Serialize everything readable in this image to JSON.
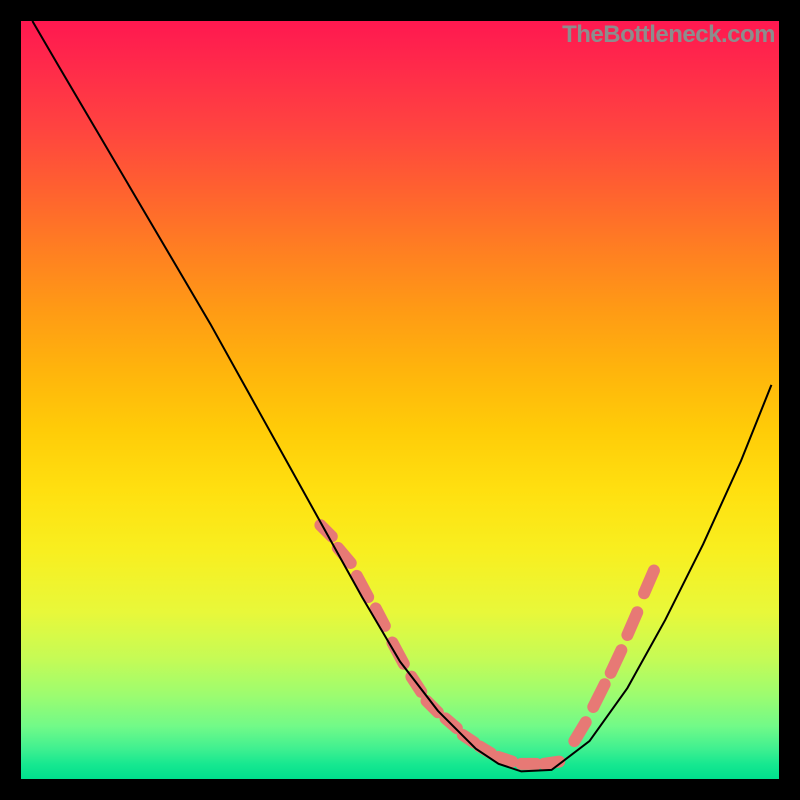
{
  "watermark": "TheBottleneck.com",
  "chart_data": {
    "type": "line",
    "title": "",
    "xlabel": "",
    "ylabel": "",
    "xlim": [
      0,
      100
    ],
    "ylim": [
      0,
      100
    ],
    "grid": false,
    "highlight_color": "#e77975",
    "highlight_width": 12,
    "series": [
      {
        "name": "bottleneck-curve",
        "color": "#000",
        "x": [
          1.5,
          5.0,
          10.0,
          15.0,
          20.0,
          25.0,
          30.0,
          35.0,
          40.0,
          45.0,
          50.0,
          55.0,
          60.0,
          63.0,
          66.0,
          70.0,
          75.0,
          80.0,
          85.0,
          90.0,
          95.0,
          99.0
        ],
        "y": [
          100,
          94,
          85.5,
          77,
          68.5,
          60,
          51,
          42,
          33,
          24,
          15.5,
          9,
          4,
          2,
          1,
          1.2,
          5,
          12,
          21,
          31,
          42,
          52
        ]
      }
    ],
    "highlight_segments": [
      {
        "x0": 39.5,
        "y0": 33.5,
        "x1": 41.0,
        "y1": 32.0
      },
      {
        "x0": 41.8,
        "y0": 30.5,
        "x1": 43.5,
        "y1": 28.5
      },
      {
        "x0": 44.3,
        "y0": 26.8,
        "x1": 45.8,
        "y1": 24.0
      },
      {
        "x0": 46.8,
        "y0": 22.5,
        "x1": 48.0,
        "y1": 20.2
      },
      {
        "x0": 49.0,
        "y0": 18.0,
        "x1": 50.5,
        "y1": 15.2
      },
      {
        "x0": 51.5,
        "y0": 13.5,
        "x1": 52.8,
        "y1": 11.5
      },
      {
        "x0": 53.5,
        "y0": 10.3,
        "x1": 55.0,
        "y1": 8.8
      },
      {
        "x0": 56.0,
        "y0": 8.0,
        "x1": 57.5,
        "y1": 6.7
      },
      {
        "x0": 58.3,
        "y0": 5.8,
        "x1": 59.8,
        "y1": 4.8
      },
      {
        "x0": 60.5,
        "y0": 4.3,
        "x1": 62.0,
        "y1": 3.4
      },
      {
        "x0": 63.0,
        "y0": 2.9,
        "x1": 64.8,
        "y1": 2.3
      },
      {
        "x0": 66.0,
        "y0": 2.0,
        "x1": 68.0,
        "y1": 2.0
      },
      {
        "x0": 69.0,
        "y0": 2.0,
        "x1": 71.0,
        "y1": 2.3
      },
      {
        "x0": 73.0,
        "y0": 5.0,
        "x1": 74.5,
        "y1": 7.5
      },
      {
        "x0": 75.5,
        "y0": 9.5,
        "x1": 77.0,
        "y1": 12.5
      },
      {
        "x0": 77.8,
        "y0": 14.0,
        "x1": 79.2,
        "y1": 17.0
      },
      {
        "x0": 80.0,
        "y0": 19.0,
        "x1": 81.3,
        "y1": 22.0
      },
      {
        "x0": 82.2,
        "y0": 24.5,
        "x1": 83.5,
        "y1": 27.5
      }
    ]
  }
}
